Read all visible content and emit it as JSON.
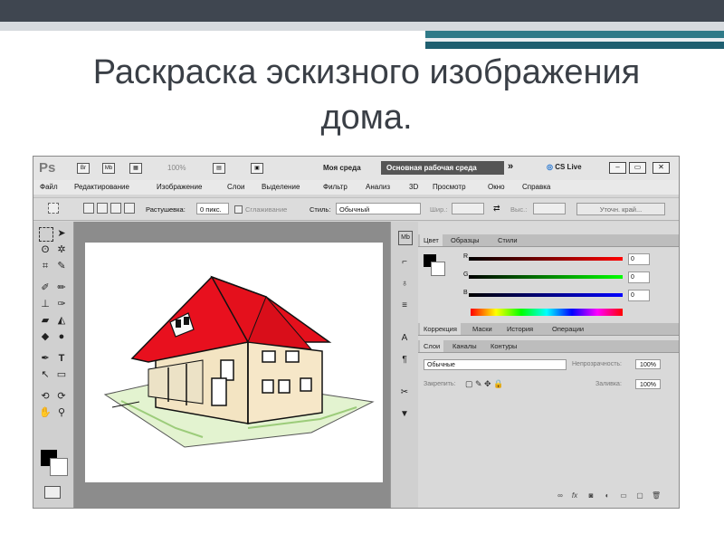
{
  "slide": {
    "title_line1": "Раскраска эскизного изображения",
    "title_line2": "дома."
  },
  "app": {
    "logo": "Ps",
    "zoom": "100%",
    "workspace_my": "Моя среда",
    "workspace_main": "Основная рабочая среда",
    "cs_live": "CS Live",
    "menu": [
      "Файл",
      "Редактирование",
      "Изображение",
      "Слои",
      "Выделение",
      "Фильтр",
      "Анализ",
      "3D",
      "Просмотр",
      "Окно",
      "Справка"
    ]
  },
  "options": {
    "feather_label": "Растушевка:",
    "feather_value": "0 пикс.",
    "antialias_label": "Сглаживание",
    "style_label": "Стиль:",
    "style_value": "Обычный",
    "width_label": "Шир.:",
    "height_label": "Выс.:",
    "refine_label": "Уточн. край..."
  },
  "color_panel": {
    "tabs": [
      "Цвет",
      "Образцы",
      "Стили"
    ],
    "r_label": "R",
    "g_label": "G",
    "b_label": "B",
    "r_value": "0",
    "g_value": "0",
    "b_value": "0"
  },
  "adjust_panel": {
    "tabs": [
      "Коррекция",
      "Маски",
      "История",
      "Операции"
    ]
  },
  "layers_panel": {
    "tabs": [
      "Слои",
      "Каналы",
      "Контуры"
    ],
    "blend_mode": "Обычные",
    "opacity_label": "Непрозрачность:",
    "opacity_value": "100%",
    "lock_label": "Закрепить:",
    "fill_label": "Заливка:",
    "fill_value": "100%"
  },
  "colors": {
    "roof": "#e8101e",
    "wall": "#f3e6c4",
    "lawn": "#dff2c8"
  }
}
